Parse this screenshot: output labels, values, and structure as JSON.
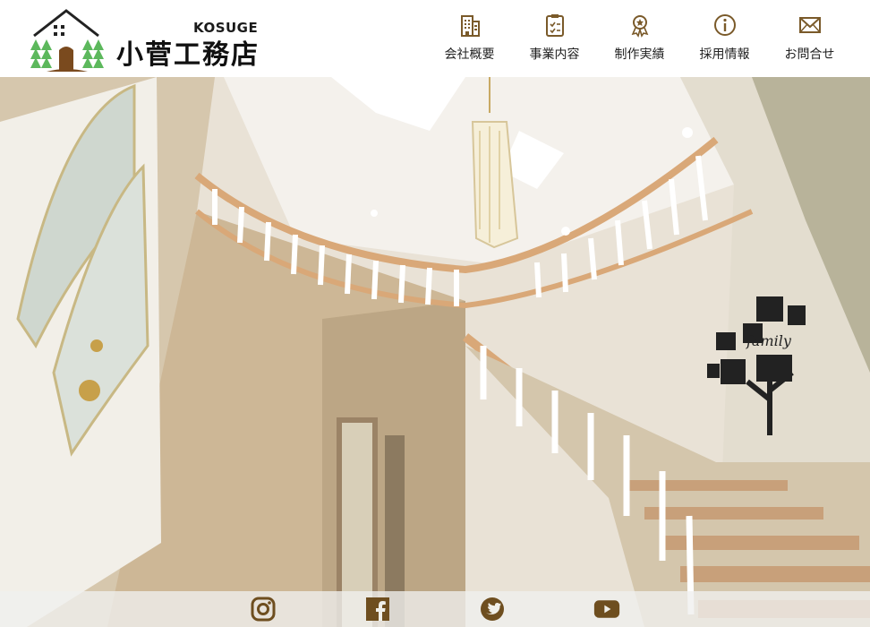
{
  "brand": {
    "roman": "KOSUGE",
    "name": "小菅工務店",
    "icon": "house-with-trees-logo"
  },
  "nav": {
    "items": [
      {
        "label": "会社概要",
        "icon": "building-icon"
      },
      {
        "label": "事業内容",
        "icon": "clipboard-icon"
      },
      {
        "label": "制作実績",
        "icon": "award-icon"
      },
      {
        "label": "採用情報",
        "icon": "info-icon"
      },
      {
        "label": "お問合せ",
        "icon": "mail-icon"
      }
    ]
  },
  "hero": {
    "image": "interior photo of a bright entrance hall with a curved white staircase, chandelier and family photo wall"
  },
  "social": {
    "items": [
      {
        "name": "instagram",
        "icon": "instagram-icon"
      },
      {
        "name": "facebook",
        "icon": "facebook-icon"
      },
      {
        "name": "twitter",
        "icon": "twitter-icon"
      },
      {
        "name": "youtube",
        "icon": "youtube-icon"
      }
    ]
  },
  "colors": {
    "accent_brown": "#7a5a2a",
    "logo_green": "#5cb85c",
    "header_bg": "#ffffff"
  }
}
